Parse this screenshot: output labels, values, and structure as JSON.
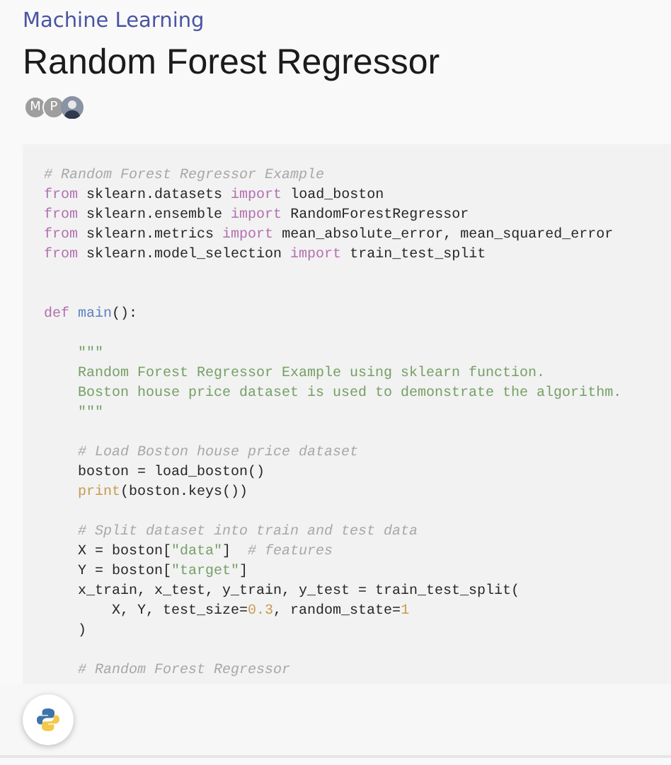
{
  "category": "Machine Learning",
  "title": "Random Forest Regressor",
  "contributors": [
    {
      "kind": "initial",
      "text": "M"
    },
    {
      "kind": "initial",
      "text": "P"
    },
    {
      "kind": "photo"
    }
  ],
  "code": {
    "lines": [
      {
        "kind": "code",
        "tokens": [
          {
            "kind": "comment",
            "text": "# Random Forest Regressor Example"
          }
        ]
      },
      {
        "kind": "code",
        "tokens": [
          {
            "kind": "keyword",
            "text": "from"
          },
          {
            "kind": "plain",
            "text": " sklearn.datasets "
          },
          {
            "kind": "keyword",
            "text": "import"
          },
          {
            "kind": "plain",
            "text": " load_boston"
          }
        ]
      },
      {
        "kind": "code",
        "tokens": [
          {
            "kind": "keyword",
            "text": "from"
          },
          {
            "kind": "plain",
            "text": " sklearn.ensemble "
          },
          {
            "kind": "keyword",
            "text": "import"
          },
          {
            "kind": "plain",
            "text": " RandomForestRegressor"
          }
        ]
      },
      {
        "kind": "code",
        "tokens": [
          {
            "kind": "keyword",
            "text": "from"
          },
          {
            "kind": "plain",
            "text": " sklearn.metrics "
          },
          {
            "kind": "keyword",
            "text": "import"
          },
          {
            "kind": "plain",
            "text": " mean_absolute_error, mean_squared_error"
          }
        ]
      },
      {
        "kind": "code",
        "tokens": [
          {
            "kind": "keyword",
            "text": "from"
          },
          {
            "kind": "plain",
            "text": " sklearn.model_selection "
          },
          {
            "kind": "keyword",
            "text": "import"
          },
          {
            "kind": "plain",
            "text": " train_test_split"
          }
        ]
      },
      {
        "kind": "blank"
      },
      {
        "kind": "blank"
      },
      {
        "kind": "code",
        "tokens": [
          {
            "kind": "keyword",
            "text": "def "
          },
          {
            "kind": "function",
            "text": "main"
          },
          {
            "kind": "plain",
            "text": "():"
          }
        ]
      },
      {
        "kind": "blank"
      },
      {
        "kind": "code",
        "tokens": [
          {
            "kind": "string",
            "text": "    \"\"\""
          }
        ]
      },
      {
        "kind": "code",
        "tokens": [
          {
            "kind": "string",
            "text": "    Random Forest Regressor Example using sklearn function."
          }
        ]
      },
      {
        "kind": "code",
        "tokens": [
          {
            "kind": "string",
            "text": "    Boston house price dataset is used to demonstrate the algorithm."
          }
        ]
      },
      {
        "kind": "code",
        "tokens": [
          {
            "kind": "string",
            "text": "    \"\"\""
          }
        ]
      },
      {
        "kind": "blank"
      },
      {
        "kind": "code",
        "tokens": [
          {
            "kind": "comment",
            "text": "    # Load Boston house price dataset"
          }
        ]
      },
      {
        "kind": "code",
        "tokens": [
          {
            "kind": "plain",
            "text": "    boston = load_boston()"
          }
        ]
      },
      {
        "kind": "code",
        "tokens": [
          {
            "kind": "builtin",
            "text": "    print"
          },
          {
            "kind": "plain",
            "text": "(boston.keys())"
          }
        ]
      },
      {
        "kind": "blank"
      },
      {
        "kind": "code",
        "tokens": [
          {
            "kind": "comment",
            "text": "    # Split dataset into train and test data"
          }
        ]
      },
      {
        "kind": "code",
        "tokens": [
          {
            "kind": "plain",
            "text": "    X = boston["
          },
          {
            "kind": "string",
            "text": "\"data\""
          },
          {
            "kind": "plain",
            "text": "]  "
          },
          {
            "kind": "comment",
            "text": "# features"
          }
        ]
      },
      {
        "kind": "code",
        "tokens": [
          {
            "kind": "plain",
            "text": "    Y = boston["
          },
          {
            "kind": "string",
            "text": "\"target\""
          },
          {
            "kind": "plain",
            "text": "]"
          }
        ]
      },
      {
        "kind": "code",
        "tokens": [
          {
            "kind": "plain",
            "text": "    x_train, x_test, y_train, y_test = train_test_split("
          }
        ]
      },
      {
        "kind": "code",
        "tokens": [
          {
            "kind": "plain",
            "text": "        X, Y, test_size="
          },
          {
            "kind": "number",
            "text": "0.3"
          },
          {
            "kind": "plain",
            "text": ", random_state="
          },
          {
            "kind": "number",
            "text": "1"
          }
        ]
      },
      {
        "kind": "code",
        "tokens": [
          {
            "kind": "plain",
            "text": "    )"
          }
        ]
      },
      {
        "kind": "blank"
      },
      {
        "kind": "code",
        "tokens": [
          {
            "kind": "comment",
            "text": "    # Random Forest Regressor"
          }
        ]
      }
    ]
  }
}
